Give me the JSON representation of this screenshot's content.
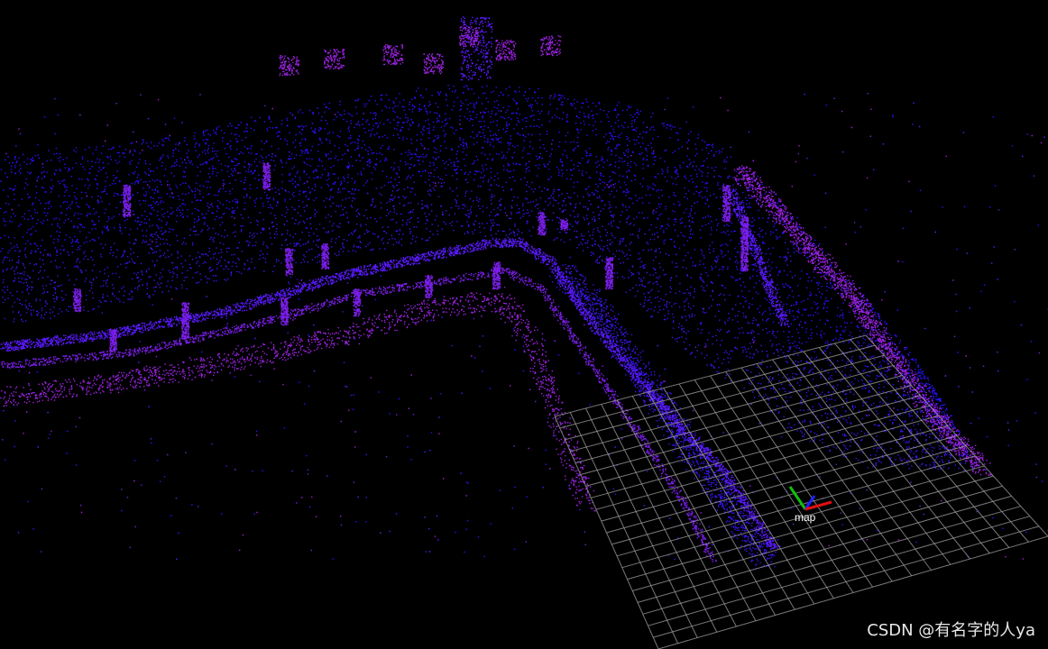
{
  "viewer": {
    "background_color": "#000000",
    "grid_color": "#a0a0a0",
    "pointcloud_colors": [
      "#2a10ff",
      "#3a14f0",
      "#5a1aff",
      "#7a1ee8",
      "#9a22e0"
    ],
    "axes": {
      "frame_label": "map",
      "x_color": "#e01010",
      "y_color": "#10c010",
      "z_color": "#2020ff"
    }
  },
  "watermark": {
    "text": "CSDN @有名字的人ya"
  }
}
